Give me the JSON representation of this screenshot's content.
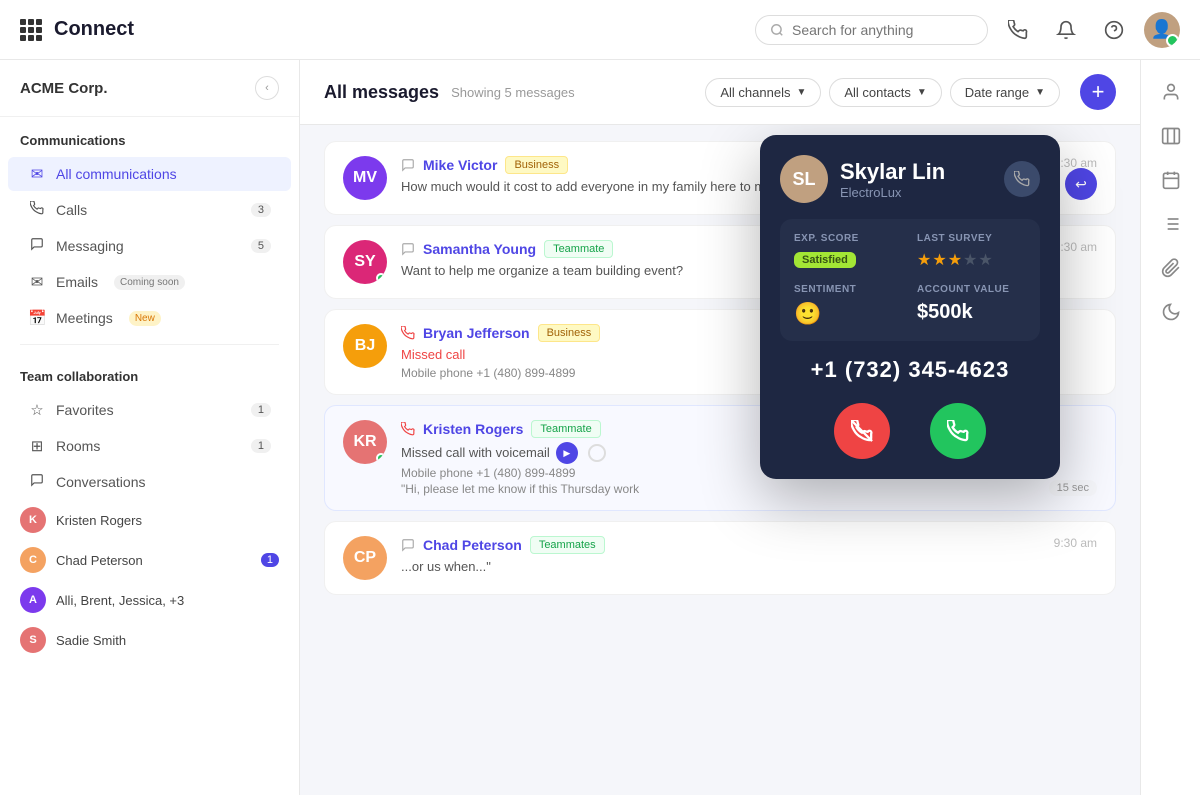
{
  "app": {
    "title": "Connect",
    "search_placeholder": "Search for anything"
  },
  "sidebar": {
    "company": "ACME Corp.",
    "communications_label": "Communications",
    "nav_items": [
      {
        "id": "all-communications",
        "label": "All communications",
        "icon": "✉",
        "active": true,
        "badge": null
      },
      {
        "id": "calls",
        "label": "Calls",
        "icon": "📞",
        "badge": "3"
      },
      {
        "id": "messaging",
        "label": "Messaging",
        "icon": "💬",
        "badge": "5"
      },
      {
        "id": "emails",
        "label": "Emails",
        "icon": "✉",
        "badge": null,
        "extra": "Coming soon"
      },
      {
        "id": "meetings",
        "label": "Meetings",
        "icon": "📅",
        "badge": null,
        "extra": "New"
      }
    ],
    "team_label": "Team collaboration",
    "team_items": [
      {
        "id": "favorites",
        "label": "Favorites",
        "icon": "☆",
        "badge": "1"
      },
      {
        "id": "rooms",
        "label": "Rooms",
        "icon": "⊞",
        "badge": "1"
      },
      {
        "id": "conversations",
        "label": "Conversations",
        "icon": "💬",
        "badge": null
      }
    ],
    "conversations": [
      {
        "name": "Kristen Rogers",
        "color": "#e57373",
        "badge": null
      },
      {
        "name": "Chad Peterson",
        "color": "#f4a261",
        "badge": "1"
      },
      {
        "name": "Alli, Brent, Jessica, +3",
        "color": "#7c3aed",
        "badge": null
      },
      {
        "name": "Sadie Smith",
        "color": "#e57373",
        "badge": null
      }
    ]
  },
  "content": {
    "title": "All messages",
    "showing": "Showing 5 messages",
    "filters": [
      "All channels",
      "All contacts",
      "Date range"
    ],
    "messages": [
      {
        "id": "mike-victor",
        "name": "Mike Victor",
        "tag": "Business",
        "tag_type": "business",
        "avatar_initials": "MV",
        "avatar_color": "#7c3aed",
        "text": "How much would it cost to add everyone in my family here to my plan?",
        "time": "9:30 am",
        "type": "message",
        "has_reply": true
      },
      {
        "id": "samantha-young",
        "name": "Samantha Young",
        "tag": "Teammate",
        "tag_type": "teammate",
        "avatar_initials": "SY",
        "avatar_color": "#db2777",
        "avatar_img": true,
        "text": "Want to help me organize a team building event?",
        "time": "9:30 am",
        "type": "message",
        "has_online": true,
        "has_reply": false
      },
      {
        "id": "bryan-jefferson",
        "name": "Bryan Jefferson",
        "tag": "Business",
        "tag_type": "business",
        "avatar_initials": "BJ",
        "avatar_color": "#f59e0b",
        "text": "Missed call",
        "subtext": "Mobile phone +1 (480) 899-4899",
        "time": null,
        "type": "call",
        "is_missed": true,
        "has_reply": false
      },
      {
        "id": "kristen-rogers",
        "name": "Kristen Rogers",
        "tag": "Teammate",
        "tag_type": "teammate",
        "avatar_initials": "KR",
        "avatar_color": "#e57373",
        "avatar_img": true,
        "text": "Missed call with voicemail",
        "subtext": "Mobile phone +1 (480) 899-4899",
        "subtext2": "\"Hi, please let me know if this Thursday work",
        "time": "15 sec",
        "type": "voicemail",
        "is_missed": true,
        "has_online": true,
        "has_reply": false
      },
      {
        "id": "chad-peterson",
        "name": "Chad Peterson",
        "tag": "Teammates",
        "tag_type": "teammates",
        "avatar_initials": "CP",
        "avatar_color": "#f4a261",
        "avatar_img": true,
        "text": "...or us when...\"",
        "time": "9:30 am",
        "type": "message",
        "has_reply": false
      }
    ]
  },
  "call_card": {
    "name": "Skylar Lin",
    "company": "ElectroLux",
    "exp_score_label": "EXP. SCORE",
    "exp_score_value": "Satisfied",
    "last_survey_label": "LAST SURVEY",
    "stars_filled": 3,
    "stars_total": 5,
    "sentiment_label": "SENTIMENT",
    "sentiment_emoji": "🙂",
    "account_value_label": "ACCOUNT VALUE",
    "account_value": "$500k",
    "phone": "+1 (732) 345-4623"
  },
  "rail_icons": [
    {
      "id": "user-icon",
      "symbol": "👤"
    },
    {
      "id": "building-icon",
      "symbol": "🏢"
    },
    {
      "id": "calendar-icon",
      "symbol": "📅"
    },
    {
      "id": "list-icon",
      "symbol": "☰"
    },
    {
      "id": "clip-icon",
      "symbol": "📎"
    },
    {
      "id": "moon-icon",
      "symbol": "🌙"
    }
  ]
}
